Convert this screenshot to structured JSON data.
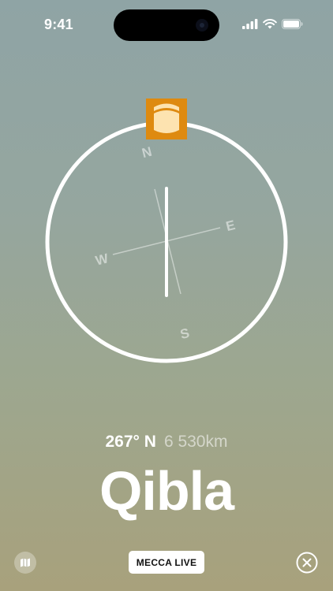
{
  "status_bar": {
    "time": "9:41"
  },
  "compass": {
    "cardinals": {
      "north": "N",
      "east": "E",
      "south": "S",
      "west": "W"
    },
    "qibla_marker_icon": "kaaba-icon",
    "marker_color": "#de8a10"
  },
  "readout": {
    "heading": "267° N",
    "distance": "6 530km"
  },
  "title": "Qibla",
  "bottom_bar": {
    "map_icon": "map-icon",
    "live_button_label": "MECCA LIVE",
    "close_icon": "close-icon"
  }
}
